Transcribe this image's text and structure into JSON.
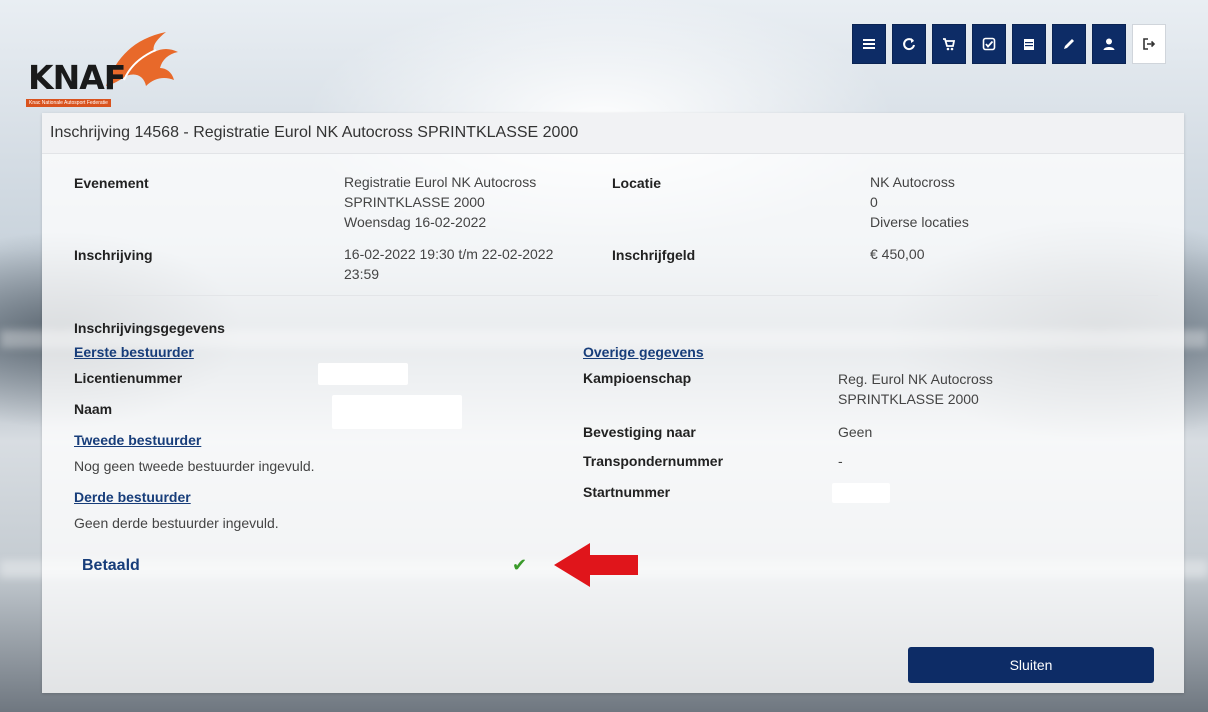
{
  "logo": {
    "text": "KNAF",
    "subtitle": "Knac Nationale Autosport Federatie"
  },
  "toolbar": {
    "icons": [
      "list-icon",
      "refresh-icon",
      "cart-icon",
      "check-badge-icon",
      "calendar-icon",
      "pencil-icon",
      "user-icon",
      "logout-icon"
    ]
  },
  "panel": {
    "title": "Inschrijving 14568 - Registratie Eurol NK Autocross SPRINTKLASSE 2000",
    "evenement_label": "Evenement",
    "evenement_lines": [
      "Registratie Eurol NK Autocross",
      "SPRINTKLASSE 2000",
      "Woensdag 16-02-2022"
    ],
    "locatie_label": "Locatie",
    "locatie_lines": [
      "NK Autocross",
      "0",
      "Diverse locaties"
    ],
    "inschrijving_label": "Inschrijving",
    "inschrijving_lines": [
      "16-02-2022 19:30 t/m 22-02-2022",
      "23:59"
    ],
    "inschrijfgeld_label": "Inschrijfgeld",
    "inschrijfgeld_value": "€ 450,00",
    "gegevens_heading": "Inschrijvingsgegevens",
    "eerste_bestuurder_link": "Eerste bestuurder",
    "licentienummer_label": "Licentienummer",
    "naam_label": "Naam",
    "tweede_bestuurder_link": "Tweede bestuurder",
    "tweede_bestuurder_text": "Nog geen tweede bestuurder ingevuld.",
    "derde_bestuurder_link": "Derde bestuurder",
    "derde_bestuurder_text": "Geen derde bestuurder ingevuld.",
    "overige_link": "Overige gegevens",
    "kampioenschap_label": "Kampioenschap",
    "kampioenschap_lines": [
      "Reg. Eurol NK Autocross",
      "SPRINTKLASSE 2000"
    ],
    "bevestiging_label": "Bevestiging naar",
    "bevestiging_value": "Geen",
    "transponder_label": "Transpondernummer",
    "transponder_value": "-",
    "startnummer_label": "Startnummer",
    "betaald_label": "Betaald",
    "betaald_check": "✔",
    "close_label": "Sluiten"
  },
  "colors": {
    "navy": "#0d2c66",
    "link": "#173d7a",
    "check": "#3a9a2a",
    "arrow": "#e0151b",
    "brand_orange": "#d9531e"
  }
}
